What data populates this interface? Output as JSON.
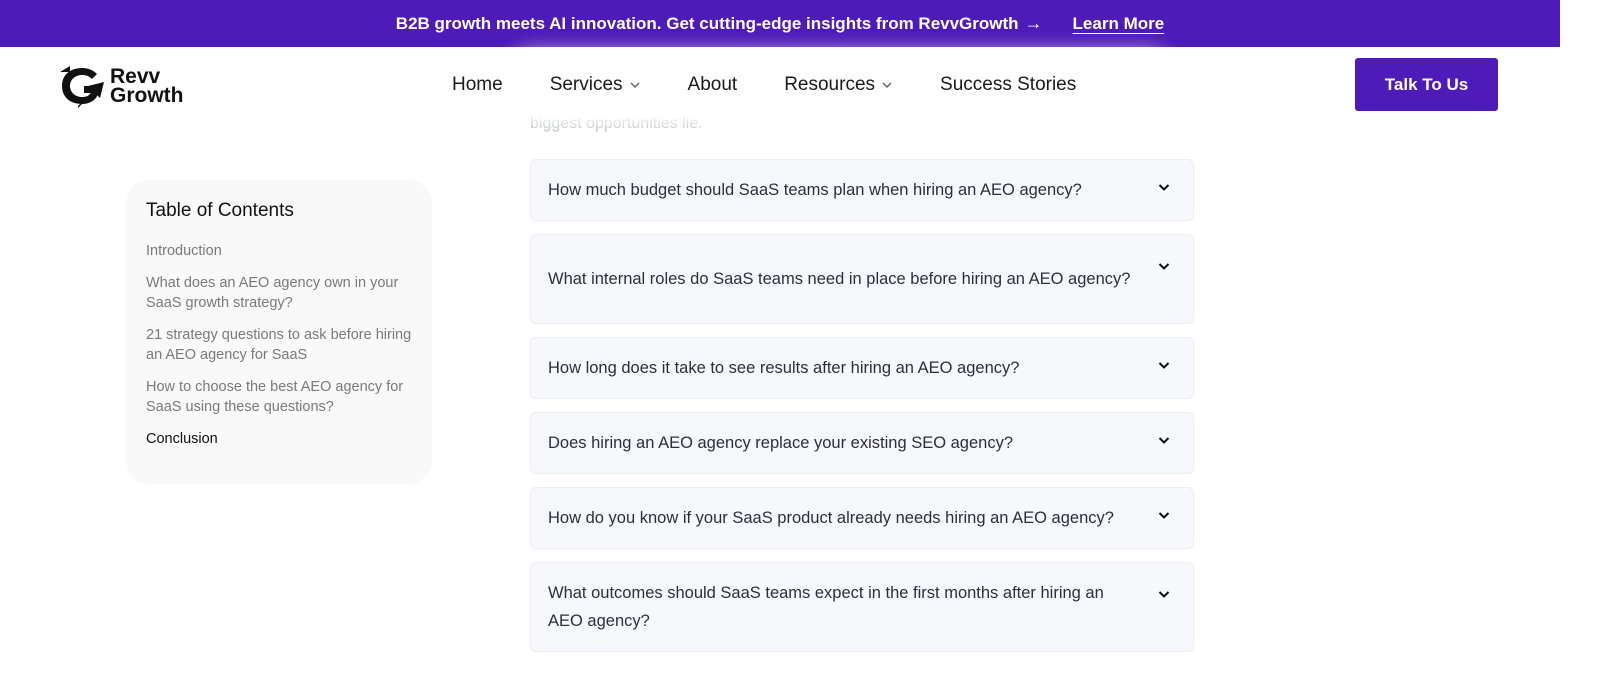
{
  "promo": {
    "text": "B2B growth meets AI innovation. Get cutting-edge insights from RevvGrowth",
    "arrow": "→",
    "link": "Learn More"
  },
  "logo": {
    "line1": "Revv",
    "line2": "Growth"
  },
  "nav": {
    "items": [
      {
        "label": "Home",
        "dropdown": false
      },
      {
        "label": "Services",
        "dropdown": true
      },
      {
        "label": "About",
        "dropdown": false
      },
      {
        "label": "Resources",
        "dropdown": true
      },
      {
        "label": "Success Stories",
        "dropdown": false
      }
    ],
    "cta": "Talk To Us"
  },
  "content": {
    "cut_text": "biggest opportunities lie."
  },
  "toc": {
    "title": "Table of Contents",
    "items": [
      {
        "label": "Introduction"
      },
      {
        "label": "What does an AEO agency own in your SaaS growth strategy?"
      },
      {
        "label": "21 strategy questions to ask before hiring an AEO agency for SaaS"
      },
      {
        "label": "How to choose the best AEO agency for SaaS using these questions?"
      },
      {
        "label": "Conclusion"
      }
    ]
  },
  "faq": [
    {
      "question": "How much budget should SaaS teams plan when hiring an AEO agency?"
    },
    {
      "question": "What internal roles do SaaS teams need in place before hiring an AEO agency?"
    },
    {
      "question": "How long does it take to see results after hiring an AEO agency?"
    },
    {
      "question": "Does hiring an AEO agency replace your existing SEO agency?"
    },
    {
      "question": "How do you know if your SaaS product already needs hiring an AEO agency?"
    },
    {
      "question": "What outcomes should SaaS teams expect in the first months after hiring an AEO agency?"
    }
  ],
  "colors": {
    "brand": "#4e1ab8",
    "card_bg": "#f7f8fc",
    "toc_bg": "#f9f9f9"
  }
}
